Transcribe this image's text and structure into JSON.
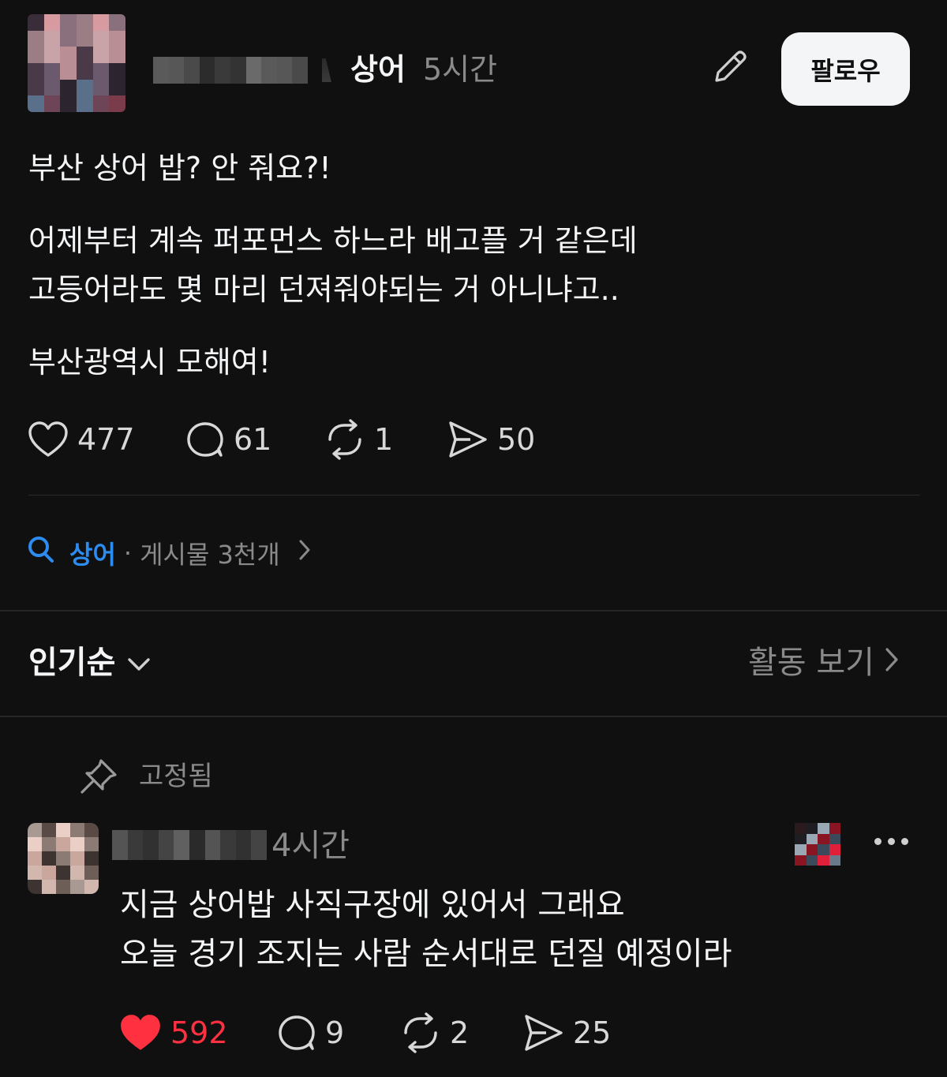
{
  "post": {
    "topic": "상어",
    "time": "5시간",
    "follow_label": "팔로우",
    "lines": [
      "부산 상어 밥? 안 줘요?!",
      "어제부터 계속 퍼포먼스 하느라 배고플 거 같은데",
      "고등어라도 몇 마리 던져줘야되는 거 아니냐고..",
      "부산광역시 모해여!"
    ],
    "stats": {
      "likes": "477",
      "comments": "61",
      "reposts": "1",
      "shares": "50"
    }
  },
  "topic_link": {
    "name": "상어",
    "separator": "·",
    "count": "게시물 3천개"
  },
  "sort": {
    "label": "인기순",
    "activity_label": "활동 보기"
  },
  "reply": {
    "pinned_label": "고정됨",
    "time": "4시간",
    "lines": [
      "지금 상어밥 사직구장에 있어서 그래요",
      "오늘 경기 조지는 사람 순서대로 던질 예정이라"
    ],
    "stats": {
      "likes": "592",
      "comments": "9",
      "reposts": "2",
      "shares": "25"
    },
    "liked": true
  },
  "colors": {
    "background": "#101010",
    "text": "#f3f5f7",
    "muted": "#8a8a8a",
    "accent_blue": "#2d8cf0",
    "like_red": "#ff3040"
  },
  "icons": {
    "edit": "pencil-icon",
    "like": "heart-icon",
    "comment": "comment-bubble-icon",
    "repost": "repost-icon",
    "share": "send-icon",
    "search": "search-icon",
    "chevron": "chevron-right-icon",
    "sort": "chevron-down-icon",
    "pin": "pin-icon",
    "more": "more-icon"
  }
}
